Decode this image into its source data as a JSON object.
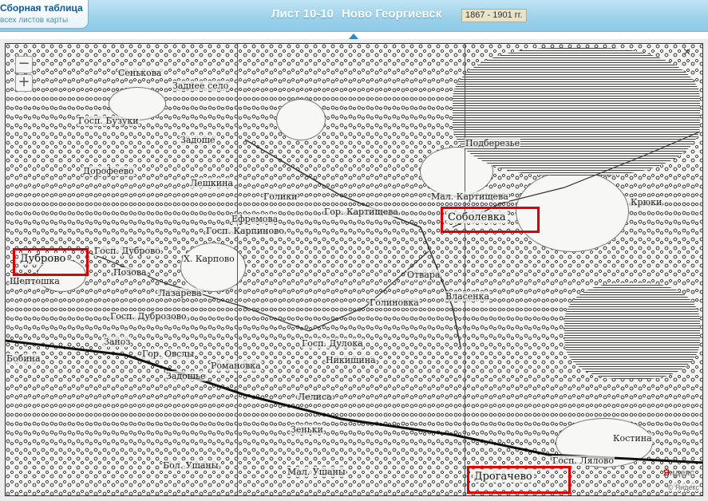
{
  "header": {
    "index_title": "Сборная таблица",
    "index_subtitle": "всех листов карты",
    "sheet_label": "Лист 10-10",
    "sheet_place": "Ново Георгиевск",
    "years": "1867 - 1901 гг."
  },
  "map": {
    "zoom_in": "+",
    "zoom_out": "−",
    "close": "×",
    "logo_a": "Я",
    "logo_b": "ндекс",
    "copyright": "© Яндекс",
    "highlighted": [
      "Дуброво",
      "Соболевка",
      "Дрогачево"
    ],
    "places": [
      "Сенькова",
      "Заднее село",
      "Госп. Бузуки",
      "Задоше",
      "Дорофеево",
      "Лешкина",
      "Голики",
      "Ефремова",
      "Госп. Карпиново",
      "Гор. Картищева",
      "Мал. Картищева",
      "Подберезье",
      "Крюки",
      "Госп. Дуброво",
      "Х. Карпово",
      "Позова",
      "Шептошка",
      "Лазарева",
      "Госп. Дуброзово",
      "Отвара",
      "Голиновка",
      "Власенка",
      "Заноз",
      "Госп. Дулока",
      "Никишина",
      "Романовка",
      "Задошье",
      "Лелиса",
      "Зеньки",
      "Бол. Ушаны",
      "Мал. Ушаны",
      "Госп. Лялово",
      "Костина",
      "Гор. Овслы",
      "Бобина"
    ]
  }
}
